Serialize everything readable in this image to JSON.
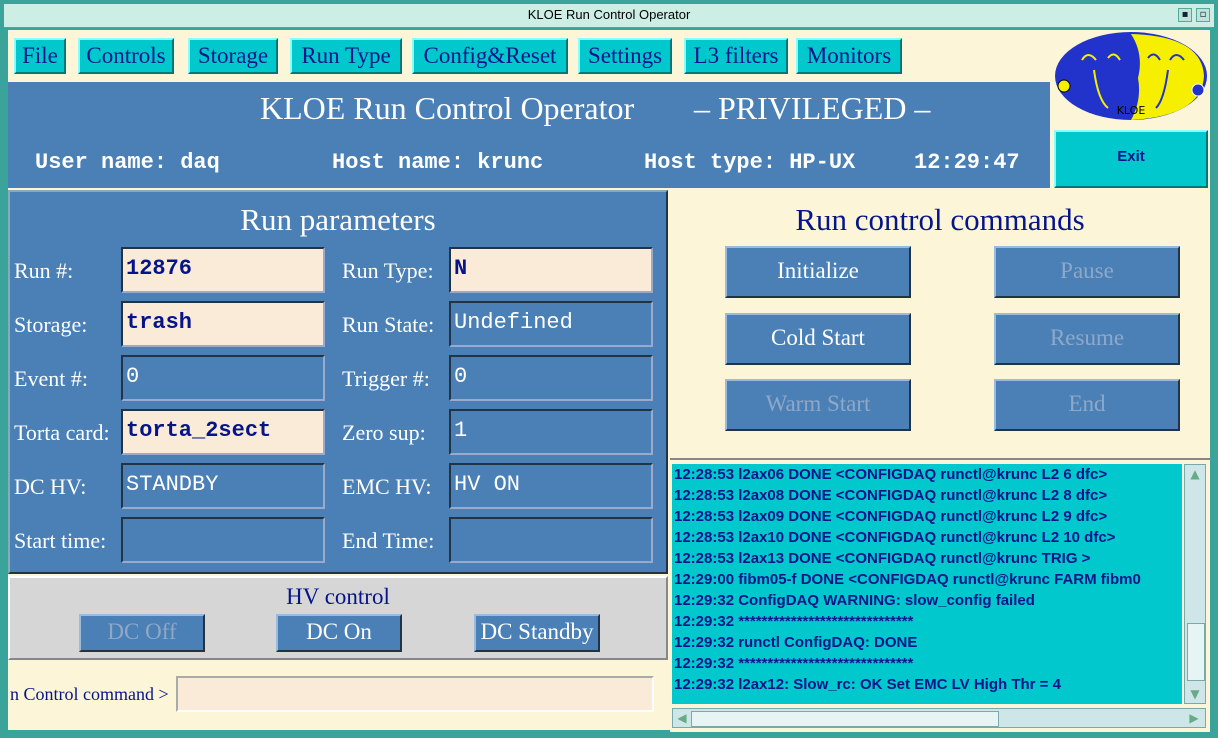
{
  "window": {
    "title": "KLOE Run Control Operator"
  },
  "menu": [
    "File",
    "Controls",
    "Storage",
    "Run Type",
    "Config&Reset",
    "Settings",
    "L3 filters",
    "Monitors"
  ],
  "header": {
    "title": "KLOE Run Control Operator",
    "mode": "– PRIVILEGED –",
    "user": "User name: daq",
    "host": "Host name: krunc",
    "host_type": "Host type: HP-UX",
    "time": "12:29:47"
  },
  "exit_label": "Exit",
  "run_parameters": {
    "title": "Run parameters",
    "run_num_label": "Run #:",
    "run_num": "12876",
    "run_type_label": "Run Type:",
    "run_type": "N",
    "storage_label": "Storage:",
    "storage": "trash",
    "run_state_label": "Run State:",
    "run_state": "Undefined",
    "event_label": "Event #:",
    "event": "0",
    "trigger_label": "Trigger #:",
    "trigger": "0",
    "torta_label": "Torta card:",
    "torta": "torta_2sect",
    "zero_label": "Zero sup:",
    "zero": "1",
    "dchv_label": "DC HV:",
    "dchv": "STANDBY",
    "emchv_label": "EMC HV:",
    "emchv": "HV ON",
    "start_label": "Start time:",
    "start": "",
    "end_label": "End Time:",
    "end": ""
  },
  "hv_control": {
    "title": "HV control",
    "dc_off": "DC Off",
    "dc_on": "DC On",
    "dc_standby": "DC Standby"
  },
  "command": {
    "label": "n Control command >",
    "value": ""
  },
  "rc_commands": {
    "title": "Run control commands",
    "initialize": "Initialize",
    "pause": "Pause",
    "cold_start": "Cold Start",
    "resume": "Resume",
    "warm_start": "Warm Start",
    "end": "End"
  },
  "log": [
    "12:28:53 l2ax06 DONE <CONFIGDAQ runctl@krunc L2 6 dfc>",
    "12:28:53 l2ax08 DONE <CONFIGDAQ runctl@krunc L2 8 dfc>",
    "12:28:53 l2ax09 DONE <CONFIGDAQ runctl@krunc L2 9 dfc>",
    "12:28:53 l2ax10 DONE <CONFIGDAQ runctl@krunc L2 10 dfc>",
    "12:28:53 l2ax13 DONE <CONFIGDAQ runctl@krunc TRIG >",
    "12:29:00 fibm05-f DONE <CONFIGDAQ runctl@krunc FARM fibm0",
    "12:29:32 ConfigDAQ WARNING: slow_config failed",
    "12:29:32 ******************************",
    "12:29:32 runctl ConfigDAQ: DONE",
    "12:29:32 ******************************",
    "12:29:32 l2ax12: Slow_rc: OK Set EMC LV High Thr = 4"
  ],
  "logo_text": "KLOE"
}
